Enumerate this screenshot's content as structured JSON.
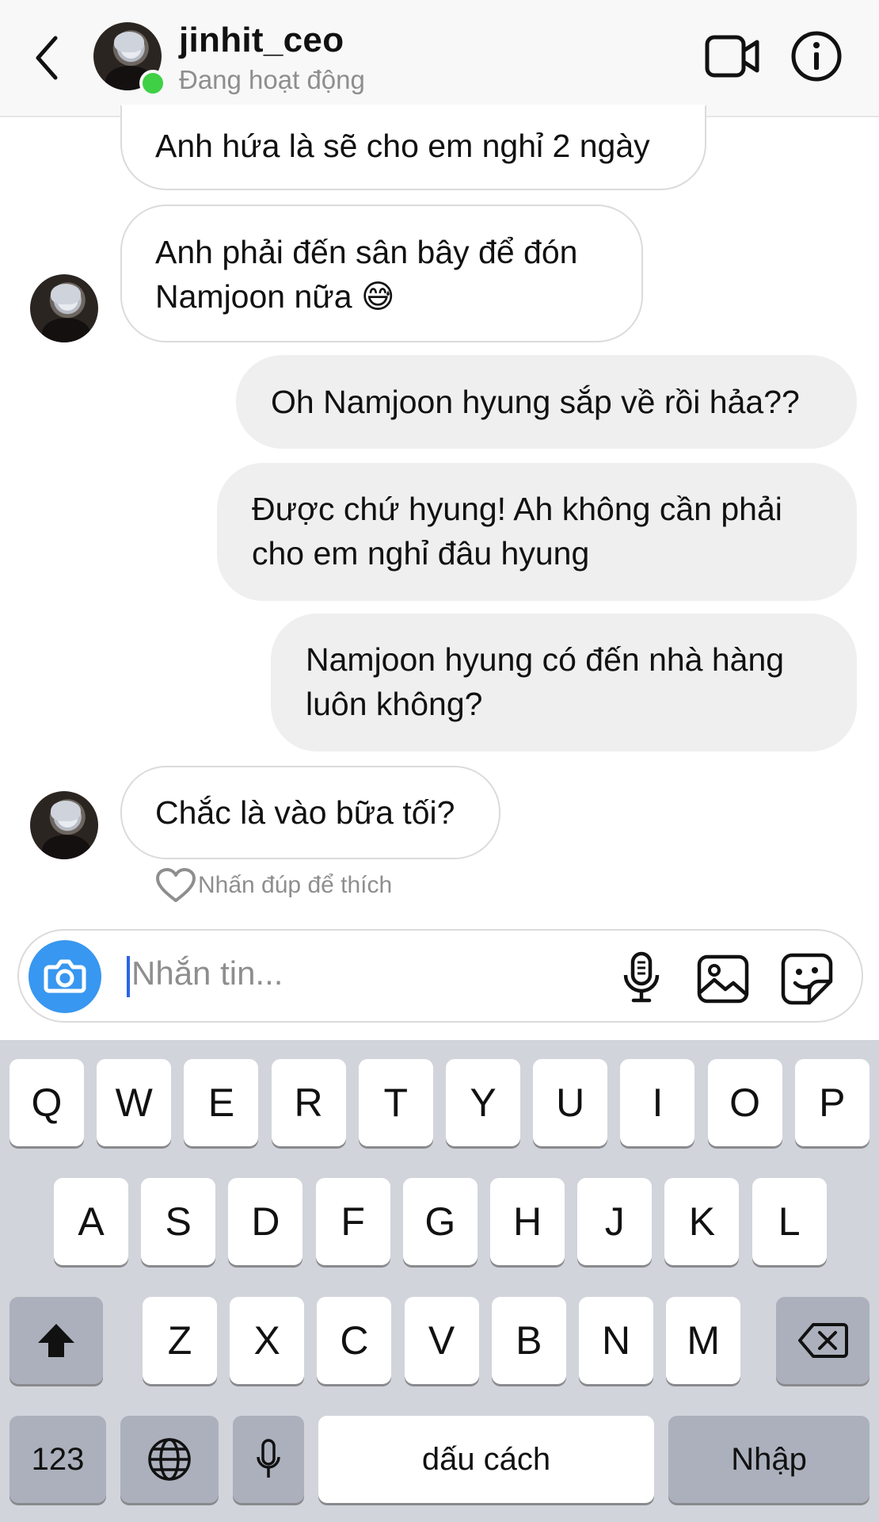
{
  "header": {
    "username": "jinhit_ceo",
    "status": "Đang hoạt động"
  },
  "messages": [
    {
      "side": "in",
      "lines": [
        "Anh hứa là sẽ cho em nghỉ 2 ngày"
      ]
    },
    {
      "side": "in",
      "lines": [
        "Anh phải đến sân bây để đón",
        "Namjoon nữa 😅"
      ]
    },
    {
      "side": "out",
      "lines": [
        "Oh Namjoon hyung sắp về rồi hảa??"
      ]
    },
    {
      "side": "out",
      "lines": [
        "Được chứ hyung! Ah không cần phải",
        "cho em nghỉ đâu hyung"
      ]
    },
    {
      "side": "out",
      "lines": [
        "Namjoon hyung có đến nhà hàng",
        "luôn không?"
      ]
    },
    {
      "side": "in",
      "lines": [
        "Chắc là vào bữa tối?"
      ]
    }
  ],
  "like_hint": "Nhấn đúp để thích",
  "composer": {
    "placeholder": "Nhắn tin..."
  },
  "keyboard": {
    "row1": [
      "Q",
      "W",
      "E",
      "R",
      "T",
      "Y",
      "U",
      "I",
      "O",
      "P"
    ],
    "row2": [
      "A",
      "S",
      "D",
      "F",
      "G",
      "H",
      "J",
      "K",
      "L"
    ],
    "row3": [
      "Z",
      "X",
      "C",
      "V",
      "B",
      "N",
      "M"
    ],
    "numbers": "123",
    "space": "dấu cách",
    "return": "Nhập"
  },
  "colors": {
    "online": "#3fd046",
    "camera_button": "#3897f0",
    "outgoing_bubble": "#efefef",
    "keyboard_bg": "#d1d4db"
  },
  "icons": [
    "back-arrow-icon",
    "video-call-icon",
    "info-icon",
    "camera-icon",
    "microphone-icon",
    "gallery-icon",
    "sticker-icon",
    "heart-icon",
    "shift-icon",
    "backspace-icon",
    "globe-icon",
    "dictation-mic-icon"
  ]
}
